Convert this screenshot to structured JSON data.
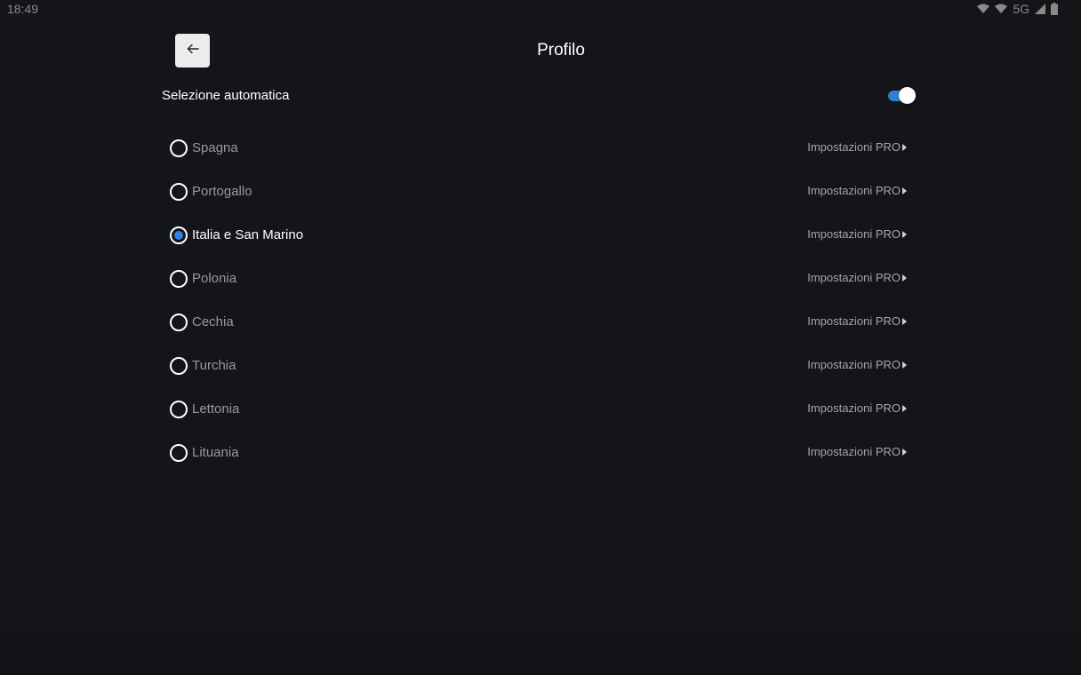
{
  "status_bar": {
    "time": "18:49",
    "network_label": "5G",
    "icons": [
      "wifi-icon",
      "wifi-icon",
      "cellular-signal-icon",
      "battery-icon"
    ]
  },
  "header": {
    "back_icon": "arrow-left-icon",
    "title": "Profilo"
  },
  "auto_selection": {
    "label": "Selezione automatica",
    "enabled": true,
    "accent_color": "#2f7fd6"
  },
  "profiles": [
    {
      "name": "Spagna",
      "selected": false,
      "link": "Impostazioni PRO"
    },
    {
      "name": "Portogallo",
      "selected": false,
      "link": "Impostazioni PRO"
    },
    {
      "name": "Italia e San Marino",
      "selected": true,
      "link": "Impostazioni PRO"
    },
    {
      "name": "Polonia",
      "selected": false,
      "link": "Impostazioni PRO"
    },
    {
      "name": "Cechia",
      "selected": false,
      "link": "Impostazioni PRO"
    },
    {
      "name": "Turchia",
      "selected": false,
      "link": "Impostazioni PRO"
    },
    {
      "name": "Lettonia",
      "selected": false,
      "link": "Impostazioni PRO"
    },
    {
      "name": "Lituania",
      "selected": false,
      "link": "Impostazioni PRO"
    }
  ],
  "colors": {
    "background": "#141518",
    "radio_selected": "#2f82e0",
    "text_primary": "#ffffff",
    "text_secondary": "#9a9a9a"
  }
}
